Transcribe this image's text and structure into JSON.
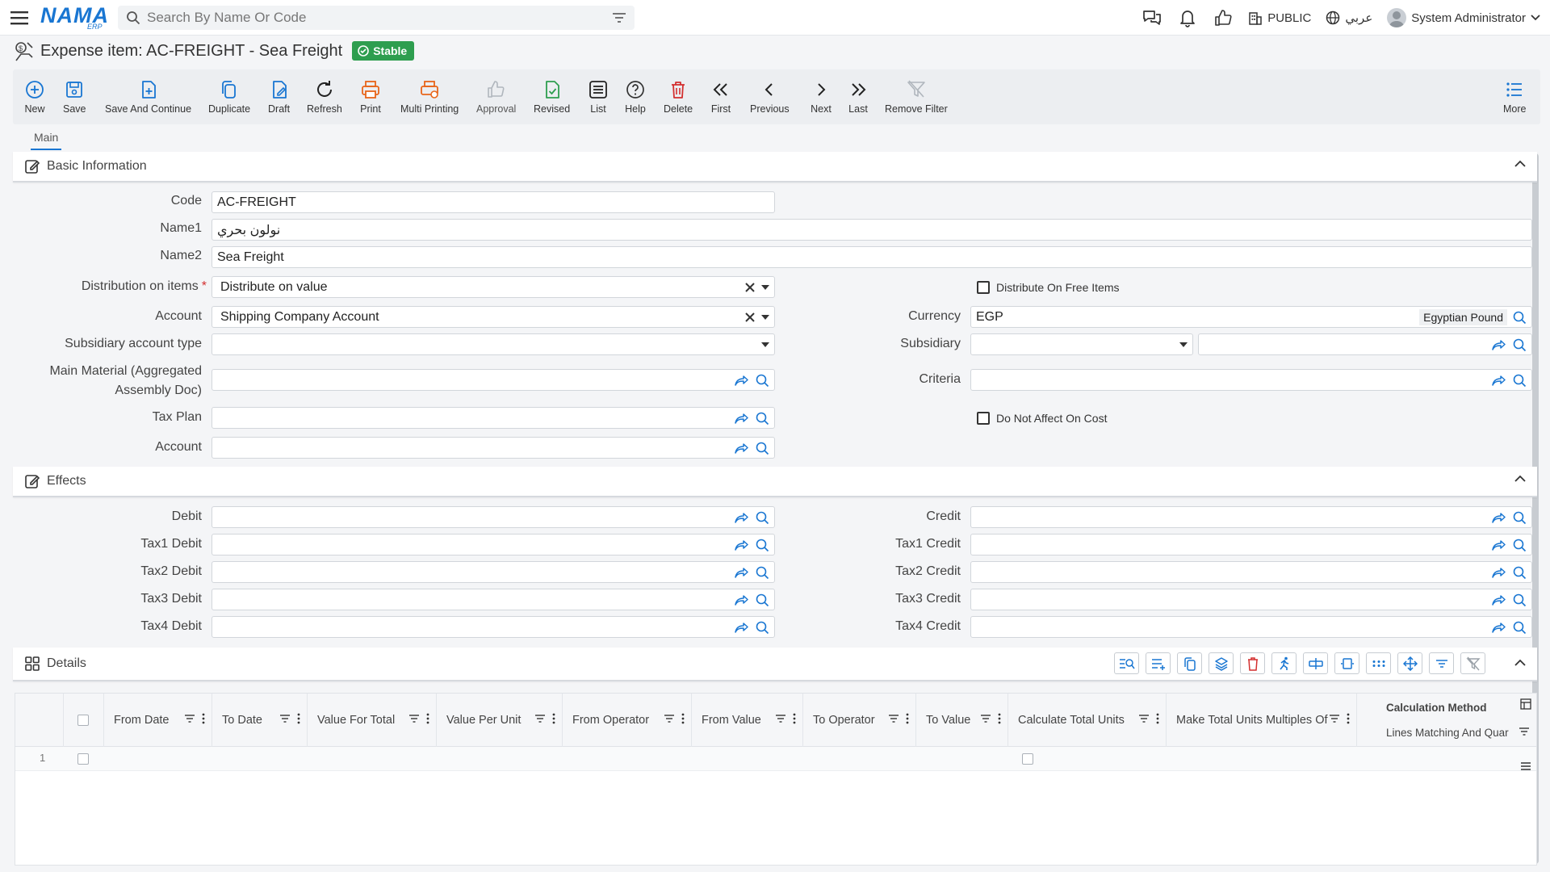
{
  "header": {
    "logo_text": "NAMA",
    "logo_sub": "ERP",
    "search_placeholder": "Search By Name Or Code",
    "icons": [
      "chat-icon",
      "bell-icon",
      "thumbs-up-icon",
      "building-icon",
      "globe-icon",
      "user-icon"
    ],
    "company": "PUBLIC",
    "language": "عربي",
    "user": "System Administrator"
  },
  "page": {
    "title": "Expense item: AC-FREIGHT - Sea Freight",
    "status": "Stable",
    "status_color": "#2e9e4f"
  },
  "toolbar": {
    "new": "New",
    "save": "Save",
    "save_continue": "Save And Continue",
    "duplicate": "Duplicate",
    "draft": "Draft",
    "refresh": "Refresh",
    "print": "Print",
    "multi_printing": "Multi Printing",
    "approval": "Approval",
    "revised": "Revised",
    "list": "List",
    "help": "Help",
    "delete": "Delete",
    "first": "First",
    "previous": "Previous",
    "next": "Next",
    "last": "Last",
    "remove_filter": "Remove Filter",
    "more": "More"
  },
  "tabs": {
    "main": "Main"
  },
  "basic": {
    "title": "Basic Information",
    "code_label": "Code",
    "code_value": "AC-FREIGHT",
    "name1_label": "Name1",
    "name1_value": "نولون بحري",
    "name2_label": "Name2",
    "name2_value": "Sea Freight",
    "distribution_label": "Distribution on items",
    "distribution_value": "Distribute on value",
    "distribute_free_label": "Distribute On Free Items",
    "distribute_free_checked": false,
    "account_label": "Account",
    "account_value": "Shipping Company Account",
    "currency_label": "Currency",
    "currency_code": "EGP",
    "currency_name": "Egyptian Pound",
    "subsidiary_type_label": "Subsidiary account type",
    "subsidiary_type_value": "",
    "subsidiary_label": "Subsidiary",
    "main_material_label_1": "Main Material (Aggregated",
    "main_material_label_2": "Assembly Doc)",
    "criteria_label": "Criteria",
    "tax_plan_label": "Tax Plan",
    "not_affect_cost_label": "Do Not Affect On Cost",
    "not_affect_cost_checked": false,
    "account2_label": "Account"
  },
  "effects": {
    "title": "Effects",
    "debit": "Debit",
    "credit": "Credit",
    "tax1_debit": "Tax1 Debit",
    "tax1_credit": "Tax1 Credit",
    "tax2_debit": "Tax2 Debit",
    "tax2_credit": "Tax2 Credit",
    "tax3_debit": "Tax3 Debit",
    "tax3_credit": "Tax3 Credit",
    "tax4_debit": "Tax4 Debit",
    "tax4_credit": "Tax4 Credit"
  },
  "details": {
    "title": "Details",
    "columns": [
      "From Date",
      "To Date",
      "Value For Total",
      "Value Per Unit",
      "From Operator",
      "From Value",
      "To Operator",
      "To Value",
      "Calculate Total Units",
      "Make Total Units Multiples Of"
    ],
    "group_header": "Calculation Method",
    "group_sub": "Lines Matching And Quar",
    "rows": [
      {
        "num": "1"
      }
    ]
  }
}
